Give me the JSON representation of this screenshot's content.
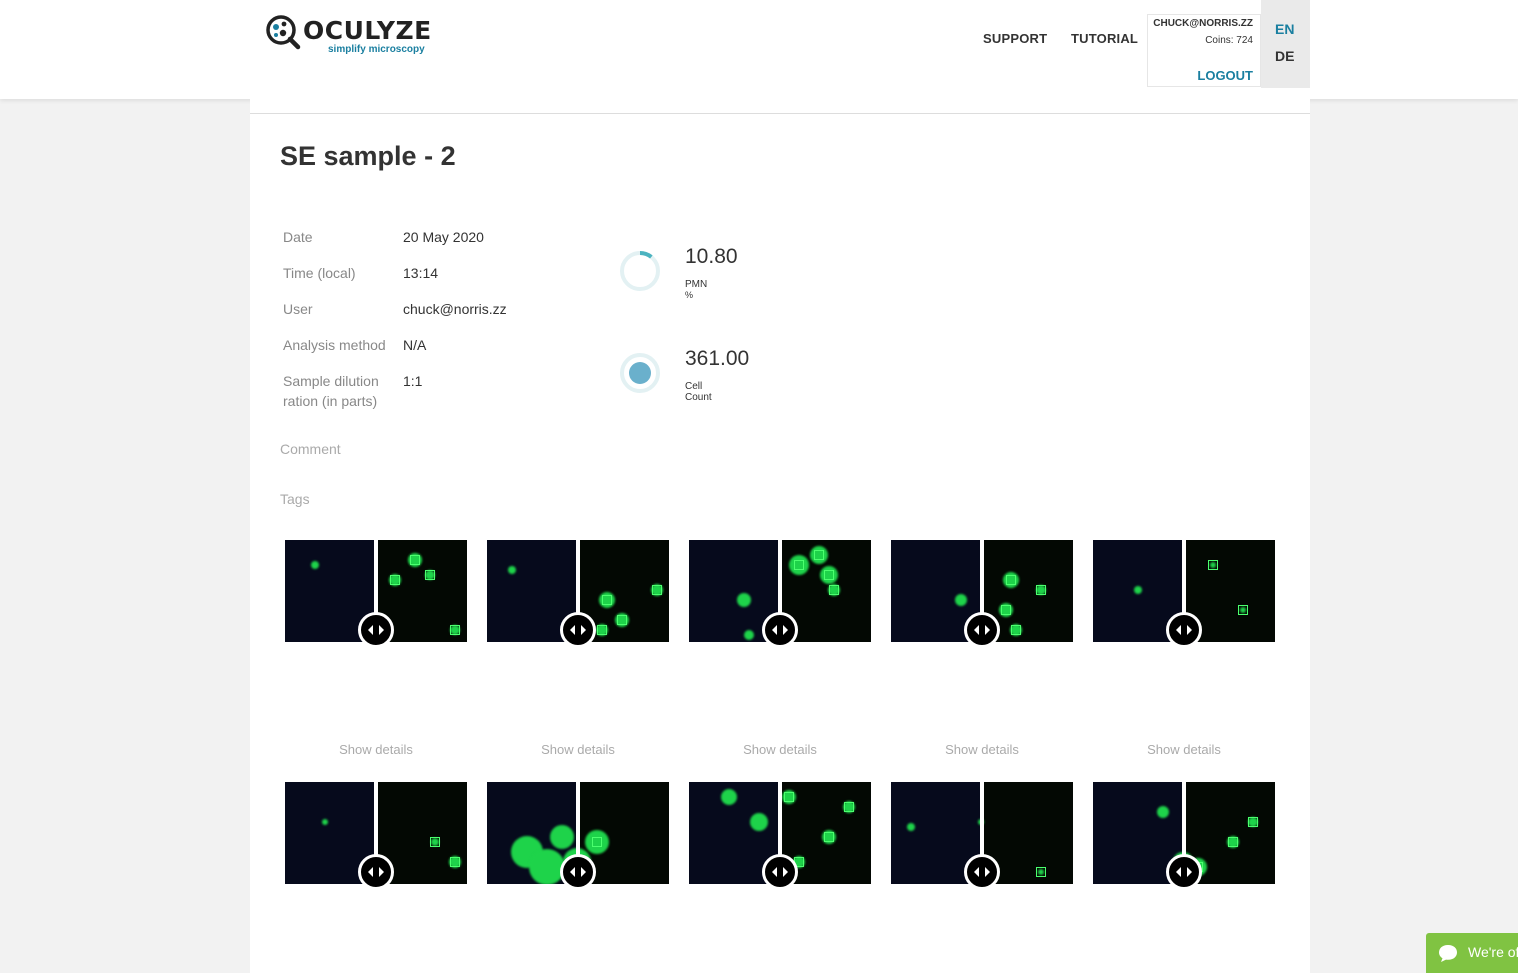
{
  "header": {
    "logo_name": "OCULYZE",
    "logo_tagline": "simplify microscopy",
    "nav": [
      "SUPPORT",
      "TUTORIAL"
    ],
    "user_email": "CHUCK@NORRIS.ZZ",
    "coins": "Coins: 724",
    "logout": "LOGOUT",
    "languages": [
      "EN",
      "DE"
    ]
  },
  "sample": {
    "title": "SE sample - 2",
    "info": [
      {
        "label": "Date",
        "value": "20 May 2020"
      },
      {
        "label": "Time (local)",
        "value": "13:14"
      },
      {
        "label": "User",
        "value": "chuck@norris.zz"
      },
      {
        "label": "Analysis method",
        "value": "N/A"
      },
      {
        "label": "Sample dilution ration (in parts)",
        "value": "1:1"
      }
    ],
    "stats": [
      {
        "value": "10.80",
        "label": "PMN",
        "unit": "%",
        "fraction": 0.108
      },
      {
        "value": "361.00",
        "label": "Cell Count",
        "unit": ""
      }
    ],
    "comment_label": "Comment",
    "tags_label": "Tags"
  },
  "images": {
    "details_label": "Show details",
    "count": 10
  },
  "chat": {
    "text": "We're offline"
  },
  "colors": {
    "accent": "#1a7fa0",
    "chat": "#80c342"
  }
}
